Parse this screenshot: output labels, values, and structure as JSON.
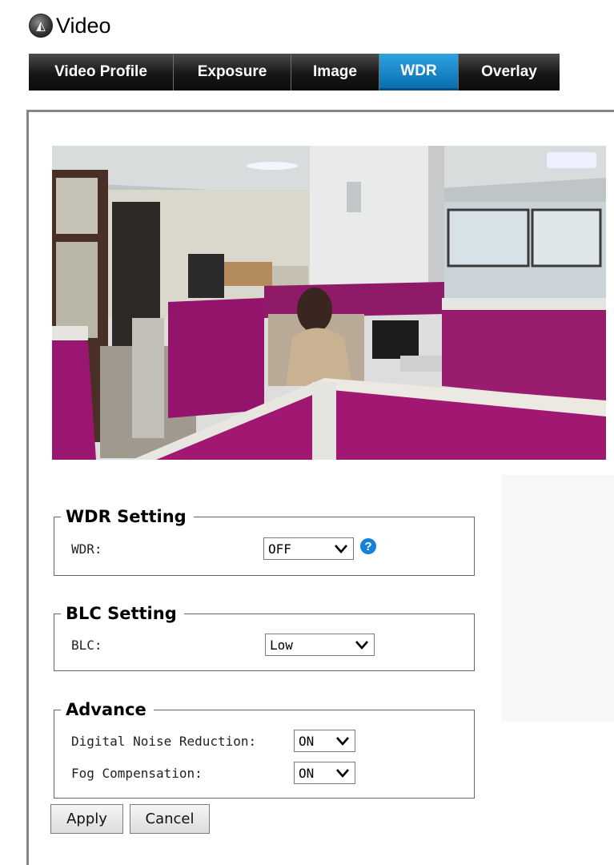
{
  "header": {
    "title": "Video",
    "icon": "camera-aperture-icon"
  },
  "tabs": [
    {
      "label": "Video Profile",
      "active": false
    },
    {
      "label": "Exposure",
      "active": false
    },
    {
      "label": "Image",
      "active": false
    },
    {
      "label": "WDR",
      "active": true
    },
    {
      "label": "Overlay",
      "active": false
    }
  ],
  "preview": {
    "description": "live camera preview"
  },
  "wdr_setting": {
    "legend": "WDR Setting",
    "wdr": {
      "label": "WDR:",
      "value": "OFF",
      "help_icon": "question-mark-icon"
    }
  },
  "blc_setting": {
    "legend": "BLC Setting",
    "blc": {
      "label": "BLC:",
      "value": "Low"
    }
  },
  "advance": {
    "legend": "Advance",
    "dnr": {
      "label": "Digital Noise Reduction:",
      "value": "ON"
    },
    "fog": {
      "label": "Fog Compensation:",
      "value": "ON"
    }
  },
  "buttons": {
    "apply": "Apply",
    "cancel": "Cancel"
  },
  "colors": {
    "active_tab": "#1a86c8",
    "tab_bg": "#1c1c1c",
    "accent_magenta": "#9c1470"
  }
}
